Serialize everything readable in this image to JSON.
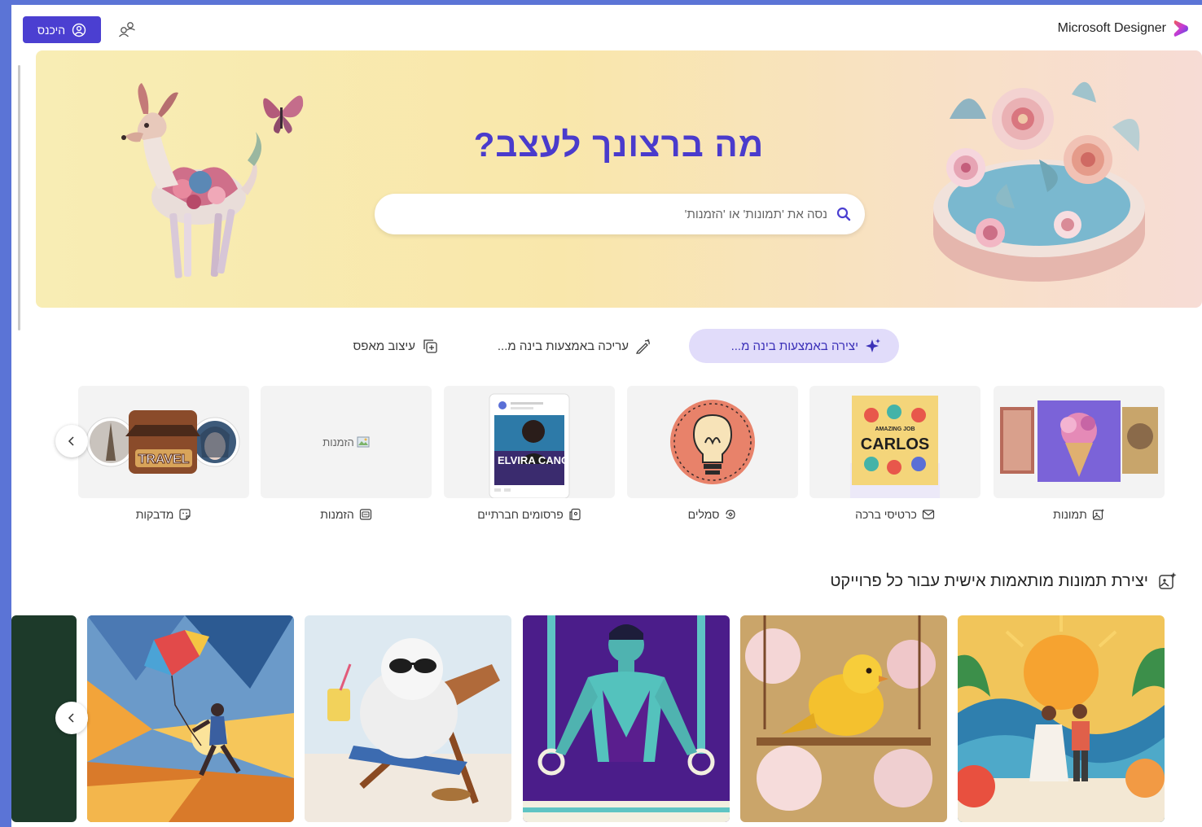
{
  "header": {
    "brand": "Microsoft Designer",
    "signin_label": "היכנס"
  },
  "hero": {
    "title": "מה ברצונך לעצב?",
    "search_placeholder": "נסה את 'תמונות' או 'הזמנות'"
  },
  "modes": [
    {
      "label": "יצירה באמצעות בינה מ...",
      "active": true,
      "icon": "sparkle-icon"
    },
    {
      "label": "עריכה באמצעות בינה מ...",
      "active": false,
      "icon": "magic-pen-icon"
    },
    {
      "label": "עיצוב מאפס",
      "active": false,
      "icon": "blank-design-icon"
    }
  ],
  "categories": [
    {
      "label": "תמונות",
      "icon": "image-sparkle-icon"
    },
    {
      "label": "כרטיסי ברכה",
      "icon": "envelope-icon",
      "card_text_top": "AMAZING JOB",
      "card_text_name": "CARLOS"
    },
    {
      "label": "סמלים",
      "icon": "logo-sparkle-icon"
    },
    {
      "label": "פרסומים חברתיים",
      "icon": "social-post-icon",
      "card_text_name": "ELVIRA CANO"
    },
    {
      "label": "הזמנות",
      "icon": "invitation-icon",
      "broken_alt": "הזמנות"
    },
    {
      "label": "מדבקות",
      "icon": "sticker-icon",
      "card_text": "TRAVEL"
    }
  ],
  "section": {
    "title": "יצירת תמונות מותאמות אישית עבור כל פרוייקט",
    "icon": "image-sparkle-icon"
  },
  "gallery": [
    {
      "name": "paper-art-couple-image"
    },
    {
      "name": "canary-bird-image"
    },
    {
      "name": "gymnast-rings-image"
    },
    {
      "name": "yeti-beach-chair-image"
    },
    {
      "name": "kite-runner-image"
    }
  ],
  "colors": {
    "accent": "#4b3fd1",
    "hero_title": "#4a3bcc",
    "active_tab_bg": "#e1dcfa",
    "page_frame": "#5b74d6"
  }
}
